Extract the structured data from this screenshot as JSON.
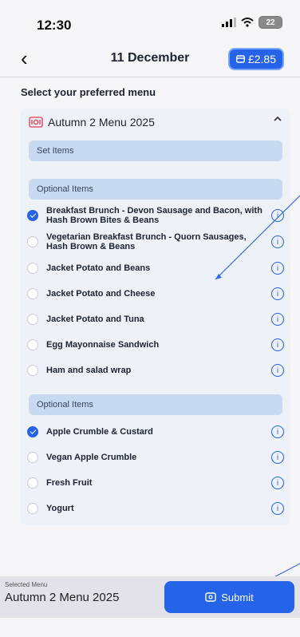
{
  "status": {
    "time": "12:30",
    "battery": "22"
  },
  "nav": {
    "back_icon": "‹",
    "title": "11 December",
    "balance": "£2.85",
    "balance_icon": "card-icon"
  },
  "page": {
    "heading": "Select your preferred menu"
  },
  "menu": {
    "title": "Autumn 2 Menu 2025",
    "icon": "menu-food-icon",
    "set_label": "Set Items",
    "section1_label": "Optional Items",
    "section2_label": "Optional Items",
    "group1": [
      {
        "label": "Breakfast Brunch - Devon Sausage and Bacon, with Hash Brown Bites & Beans",
        "selected": true
      },
      {
        "label": "Vegetarian Breakfast Brunch - Quorn Sausages, Hash Brown & Beans",
        "selected": false
      },
      {
        "label": "Jacket Potato and Beans",
        "selected": false
      },
      {
        "label": "Jacket Potato and Cheese",
        "selected": false
      },
      {
        "label": "Jacket Potato and Tuna",
        "selected": false
      },
      {
        "label": "Egg Mayonnaise Sandwich",
        "selected": false
      },
      {
        "label": "Ham and salad wrap",
        "selected": false
      }
    ],
    "group2": [
      {
        "label": "Apple Crumble & Custard",
        "selected": true
      },
      {
        "label": "Vegan Apple Crumble",
        "selected": false
      },
      {
        "label": "Fresh Fruit",
        "selected": false
      },
      {
        "label": "Yogurt",
        "selected": false
      }
    ]
  },
  "footer": {
    "selected_label": "Selected Menu",
    "selected_value": "Autumn 2 Menu 2025",
    "submit_label": "Submit"
  }
}
